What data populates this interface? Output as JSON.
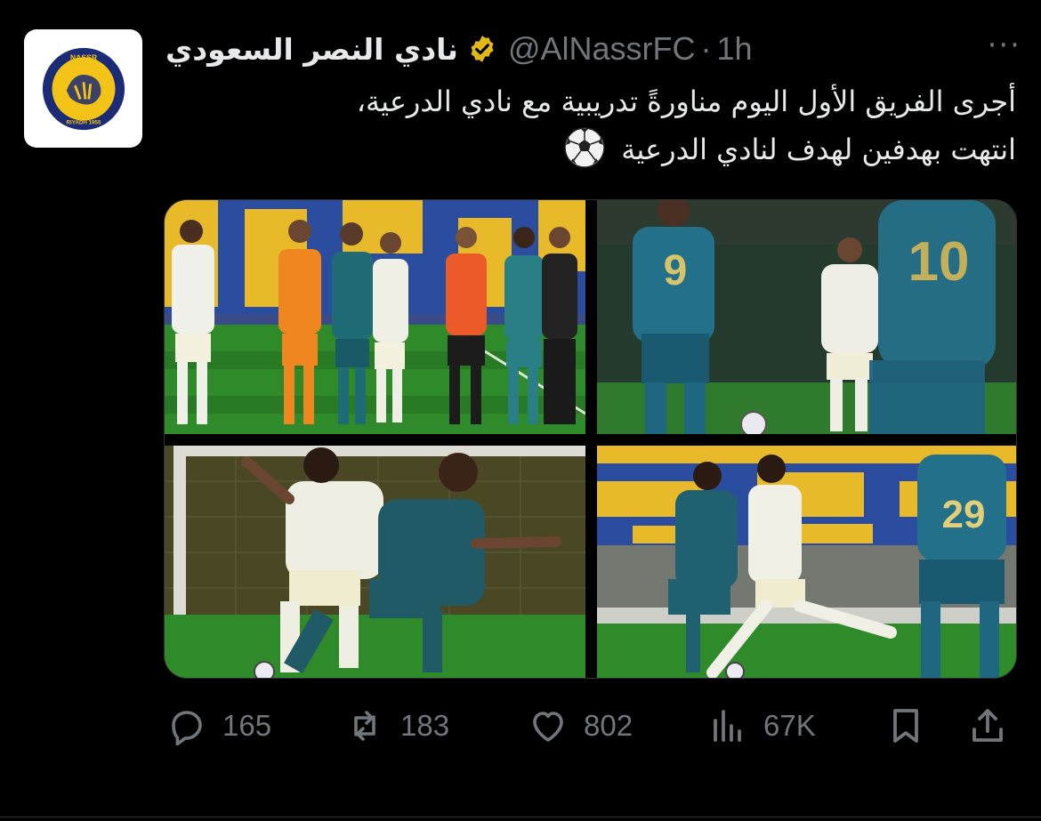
{
  "tweet": {
    "display_name": "نادي النصر السعودي",
    "handle": "@AlNassrFC",
    "separator": "·",
    "time": "1h",
    "more_label": "···",
    "text_line1": "أجرى الفريق الأول اليوم مناورةً تدريبية مع نادي الدرعية،",
    "text_line2": "انتهت بهدفين لهدف لنادي الدرعية"
  },
  "avatar": {
    "logo_text_top": "NASSR",
    "logo_text_bottom": "RIYADH 1955"
  },
  "media": {
    "photo_count": 4,
    "player_numbers": [
      "9",
      "10",
      "29"
    ]
  },
  "actions": {
    "replies": "165",
    "reposts": "183",
    "likes": "802",
    "views": "67K"
  },
  "colors": {
    "background": "#000000",
    "text_primary": "#e7e9ea",
    "text_secondary": "#71767b",
    "verified_badge": "#e2b719",
    "club_yellow": "#f3c317",
    "club_navy": "#1b2b75"
  },
  "icons": [
    "reply-icon",
    "repost-icon",
    "like-icon",
    "views-icon",
    "bookmark-icon",
    "share-icon",
    "verified-badge-icon",
    "soccer-ball-icon",
    "more-icon"
  ]
}
